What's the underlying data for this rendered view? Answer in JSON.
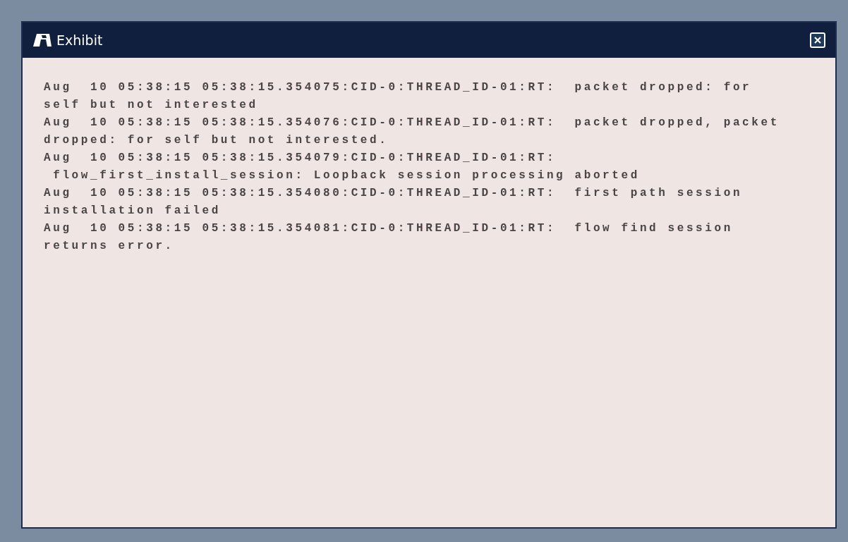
{
  "window": {
    "title": "Exhibit"
  },
  "log_lines": [
    "Aug  10 05:38:15 05:38:15.354075:CID-0:THREAD_ID-01:RT:  packet dropped: for",
    "self but not interested",
    "Aug  10 05:38:15 05:38:15.354076:CID-0:THREAD_ID-01:RT:  packet dropped, packet",
    "dropped: for self but not interested.",
    "Aug  10 05:38:15 05:38:15.354079:CID-0:THREAD_ID-01:RT:",
    " flow_first_install_session: Loopback session processing aborted",
    "Aug  10 05:38:15 05:38:15.354080:CID-0:THREAD_ID-01:RT:  first path session",
    "installation failed",
    "Aug  10 05:38:15 05:38:15.354081:CID-0:THREAD_ID-01:RT:  flow find session",
    "returns error."
  ]
}
